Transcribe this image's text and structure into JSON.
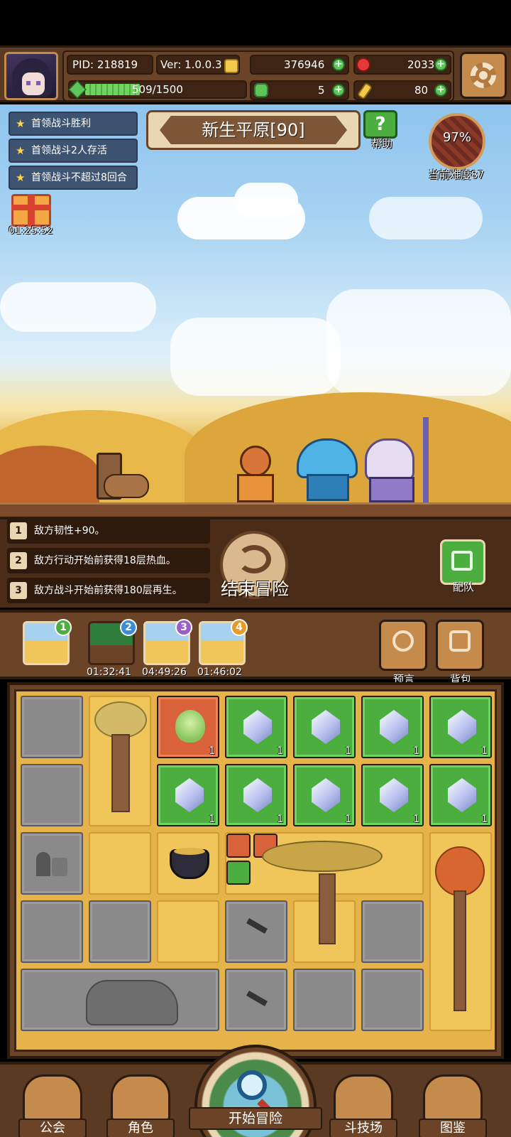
{
  "player": {
    "pid": "PID: 218819",
    "version": "Ver: 1.0.0.3",
    "xp_text": "509/1500",
    "xp_fraction": 0.34
  },
  "currencies": {
    "coins": "376946",
    "gems": "2033",
    "clover": "5",
    "keys": "80"
  },
  "quests": [
    {
      "text": "首领战斗胜利"
    },
    {
      "text": "首领战斗2人存活"
    },
    {
      "text": "首领战斗不超过8回合"
    }
  ],
  "gift": {
    "timer": "01:25:52"
  },
  "area": {
    "name": "新生平原[90]"
  },
  "help": {
    "label": "帮助",
    "icon": "?"
  },
  "difficulty": {
    "percent": "97%",
    "label": "当前难度87"
  },
  "effects": [
    {
      "num": "1",
      "text": "敌方韧性+90。"
    },
    {
      "num": "2",
      "text": "敌方行动开始前获得18层热血。"
    },
    {
      "num": "3",
      "text": "敌方战斗开始前获得180层再生。"
    }
  ],
  "end_button": {
    "label": "结束冒险"
  },
  "team_button": {
    "label": "配队"
  },
  "maps": [
    {
      "badge": "1",
      "timer": "",
      "badge_color": "#4cae3f"
    },
    {
      "badge": "2",
      "timer": "01:32:41",
      "badge_color": "#3a8ed6"
    },
    {
      "badge": "3",
      "timer": "04:49:26",
      "badge_color": "#9b5ec9"
    },
    {
      "badge": "4",
      "timer": "01:46:02",
      "badge_color": "#e89a2c"
    }
  ],
  "side_buttons": {
    "prophecy": "预言",
    "bag": "背包"
  },
  "grid_items": {
    "qty": "1"
  },
  "nav": {
    "guild": "公会",
    "character": "角色",
    "start": "开始冒险",
    "arena": "斗技场",
    "codex": "图鉴"
  },
  "colors": {
    "wood_dark": "#2b1a0e",
    "wood": "#6b4427",
    "tile_green": "#4cae3f",
    "tile_sand": "#f0c55a",
    "tile_rock": "#8a8a8a"
  }
}
